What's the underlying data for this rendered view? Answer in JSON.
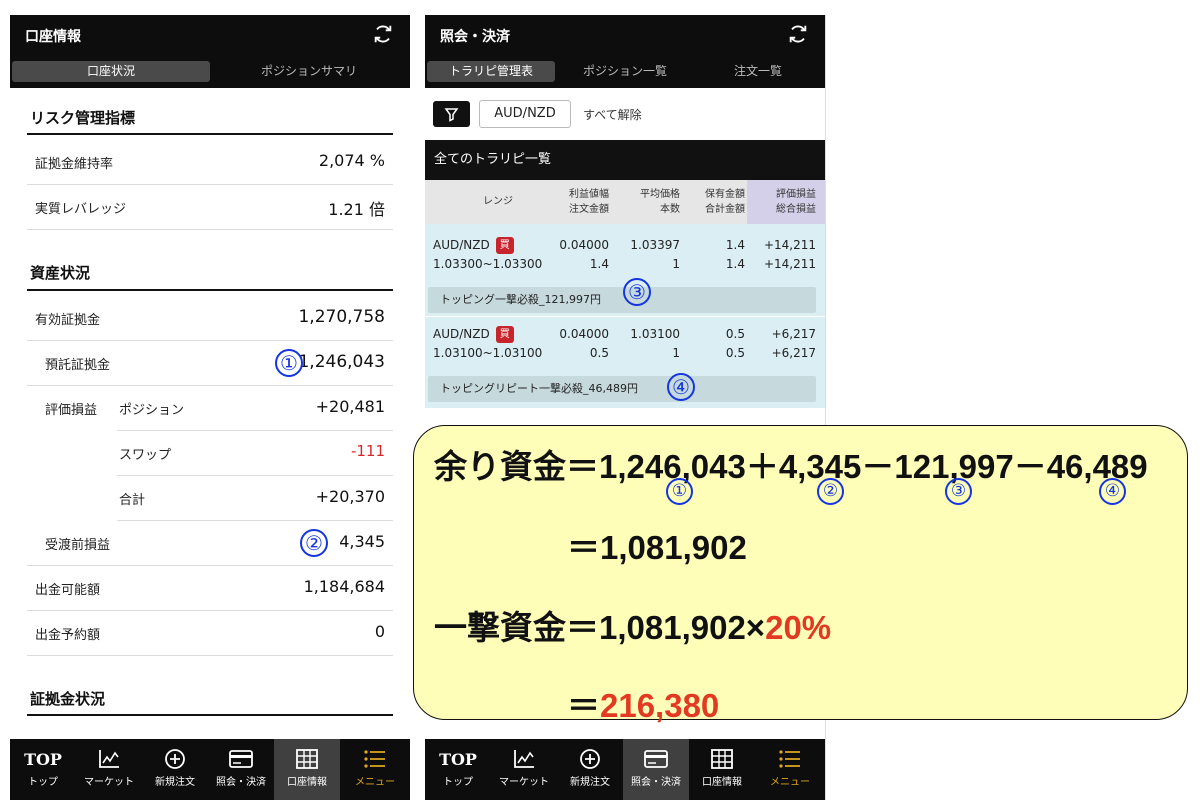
{
  "left_panel": {
    "title": "口座情報",
    "tabs": [
      "口座状況",
      "ポジションサマリ"
    ],
    "risk_section": "リスク管理指標",
    "margin_ratio_label": "証拠金維持率",
    "margin_ratio_value": "2,074 %",
    "leverage_label": "実質レバレッジ",
    "leverage_value": "1.21 倍",
    "assets_section": "資産状況",
    "effective_margin_label": "有効証拠金",
    "effective_margin_value": "1,270,758",
    "deposit_label": "預託証拠金",
    "deposit_value": "1,246,043",
    "unrealized_label": "評価損益",
    "position_label": "ポジション",
    "position_value": "+20,481",
    "swap_label": "スワップ",
    "swap_value": "-111",
    "total_label": "合計",
    "total_value": "+20,370",
    "pre_settlement_label": "受渡前損益",
    "pre_settlement_value": "4,345",
    "withdrawable_label": "出金可能額",
    "withdrawable_value": "1,184,684",
    "withdraw_reserved_label": "出金予約額",
    "withdraw_reserved_value": "0",
    "margin_section": "証拠金状況"
  },
  "right_panel": {
    "title": "照会・決済",
    "tabs": [
      "トラリピ管理表",
      "ポジション一覧",
      "注文一覧"
    ],
    "filter_pair": "AUD/NZD",
    "clear_all": "すべて解除",
    "list_title": "全てのトラリピ一覧",
    "columns": {
      "range": "レンジ",
      "profit_width": "利益値幅",
      "order_amount": "注文金額",
      "avg_price": "平均価格",
      "count": "本数",
      "held_amount": "保有金額",
      "total_amount": "合計金額",
      "unrealized": "評価損益",
      "total_pl": "総合損益"
    },
    "traps": [
      {
        "pair": "AUD/NZD",
        "side": "買",
        "range": "1.03300~1.03300",
        "profit_width": "0.04000",
        "order_amount": "1.4",
        "avg_price": "1.03397",
        "count": "1",
        "held_amount": "1.4",
        "total_amount": "1.4",
        "unrealized": "+14,211",
        "total_pl": "+14,211",
        "strategy": "トッピング一撃必殺_121,997円"
      },
      {
        "pair": "AUD/NZD",
        "side": "買",
        "range": "1.03100~1.03100",
        "profit_width": "0.04000",
        "order_amount": "0.5",
        "avg_price": "1.03100",
        "count": "1",
        "held_amount": "0.5",
        "total_amount": "0.5",
        "unrealized": "+6,217",
        "total_pl": "+6,217",
        "strategy": "トッピングリピート一撃必殺_46,489円"
      }
    ]
  },
  "bottom_nav": [
    {
      "label": "トップ",
      "top": "TOP",
      "icon": "top-text"
    },
    {
      "label": "マーケット",
      "icon": "chart-icon"
    },
    {
      "label": "新規注文",
      "icon": "plus-circle-icon"
    },
    {
      "label": "照会・決済",
      "icon": "card-icon"
    },
    {
      "label": "口座情報",
      "icon": "grid-icon"
    },
    {
      "label": "メニュー",
      "icon": "menu-icon"
    }
  ],
  "markers": [
    "①",
    "②",
    "③",
    "④"
  ],
  "formula": {
    "line1_label": "余り資金＝",
    "line1_a": "1,246,043",
    "plus": "＋",
    "line1_b": "4,345",
    "minus": "－",
    "line1_c": "121,997",
    "line1_d": "46,489",
    "line2": "＝1,081,902",
    "line3_label": "一撃資金＝1,081,902×",
    "line3_pct": "20%",
    "line4_eq": "＝",
    "line4_value": "216,380"
  },
  "colors": {
    "marker_blue": "#1435e0",
    "highlight_red": "#e23a22",
    "negative_red": "#d8272a",
    "box_yellow": "#fefeb8",
    "trap_bg": "#daeef3",
    "header_black": "#0d0d0d",
    "menu_gold": "#e0a820"
  }
}
